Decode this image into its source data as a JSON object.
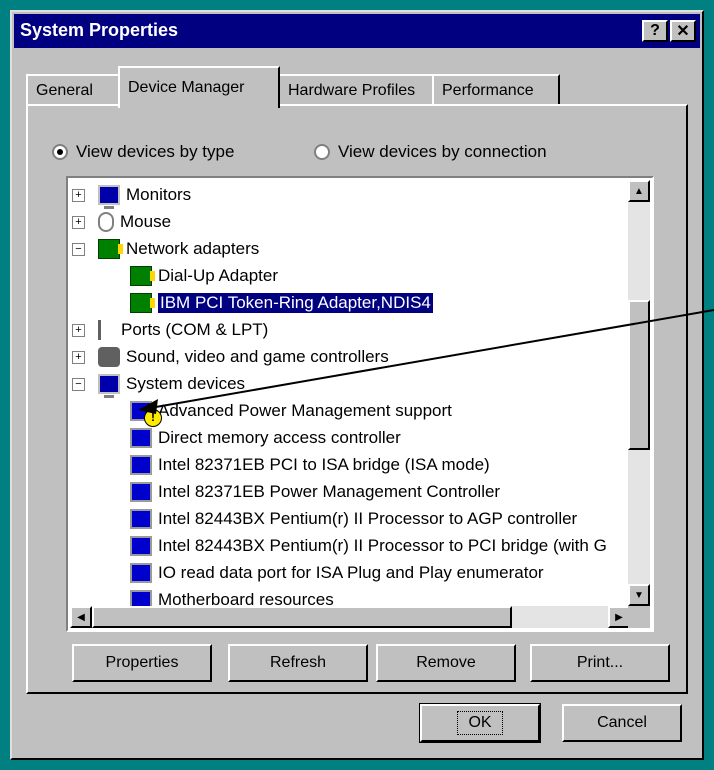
{
  "window": {
    "title": "System Properties",
    "help_label": "?",
    "close_label": "✕"
  },
  "tabs": [
    "General",
    "Device Manager",
    "Hardware Profiles",
    "Performance"
  ],
  "view": {
    "by_type": "View devices by type",
    "by_connection": "View devices by connection",
    "selected": "by_type"
  },
  "tree": [
    {
      "label": "Monitors",
      "icon": "monitor-icon",
      "expander": "+"
    },
    {
      "label": "Mouse",
      "icon": "mouse-icon",
      "expander": "+"
    },
    {
      "label": "Network adapters",
      "icon": "network-card-icon",
      "expander": "−"
    },
    {
      "label": "Dial-Up Adapter",
      "icon": "network-card-icon"
    },
    {
      "label": "IBM PCI Token-Ring Adapter,NDIS4",
      "icon": "network-card-icon",
      "selected": true
    },
    {
      "label": "Ports (COM & LPT)",
      "icon": "port-icon",
      "expander": "+"
    },
    {
      "label": "Sound, video and game controllers",
      "icon": "sound-icon",
      "expander": "+"
    },
    {
      "label": "System devices",
      "icon": "computer-icon",
      "expander": "−"
    },
    {
      "label": "Advanced Power Management support",
      "icon": "warning-device-icon",
      "warning": true
    },
    {
      "label": "Direct memory access controller",
      "icon": "system-device-icon"
    },
    {
      "label": "Intel 82371EB PCI to ISA bridge (ISA mode)",
      "icon": "system-device-icon"
    },
    {
      "label": "Intel 82371EB Power Management Controller",
      "icon": "system-device-icon"
    },
    {
      "label": "Intel 82443BX Pentium(r) II Processor to AGP controller",
      "icon": "system-device-icon"
    },
    {
      "label": "Intel 82443BX Pentium(r) II Processor to PCI bridge (with G",
      "icon": "system-device-icon"
    },
    {
      "label": "IO read data port for ISA Plug and Play enumerator",
      "icon": "system-device-icon"
    },
    {
      "label": "Motherboard resources",
      "icon": "system-device-icon"
    }
  ],
  "buttons": {
    "properties": "Properties",
    "refresh": "Refresh",
    "remove": "Remove",
    "print": "Print...",
    "ok": "OK",
    "cancel": "Cancel"
  },
  "colors": {
    "titlebar": "#000080",
    "selection": "#000080",
    "desktop": "#008080"
  }
}
